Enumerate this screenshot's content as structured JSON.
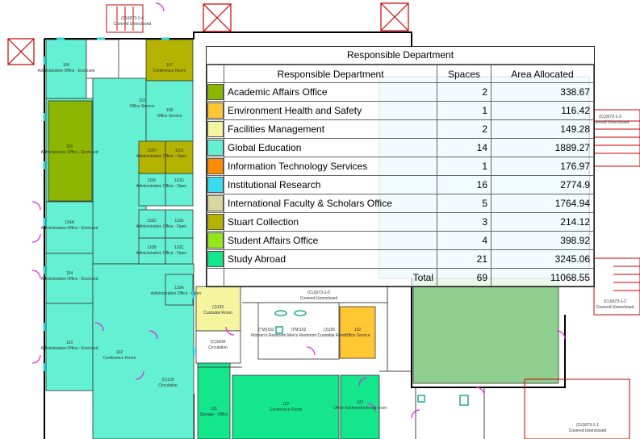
{
  "legend": {
    "title": "Responsible Department",
    "headers": {
      "department": "Responsible Department",
      "spaces": "Spaces",
      "area": "Area Allocated"
    },
    "rows": [
      {
        "color": "#8db600",
        "name": "Academic Affairs Office",
        "spaces": "2",
        "area": "338.67"
      },
      {
        "color": "#ffc732",
        "name": "Environment Health and Safety",
        "spaces": "1",
        "area": "116.42"
      },
      {
        "color": "#f5f5a0",
        "name": "Facilities Management",
        "spaces": "2",
        "area": "149.28"
      },
      {
        "color": "#64f0d2",
        "name": "Global Education",
        "spaces": "14",
        "area": "1889.27"
      },
      {
        "color": "#ff8c00",
        "name": "Information Technology Services",
        "spaces": "1",
        "area": "176.97"
      },
      {
        "color": "#3cdcf0",
        "name": "Institutional Research",
        "spaces": "16",
        "area": "2774.9"
      },
      {
        "color": "#d7d7a0",
        "name": "International Faculty & Scholars Office",
        "spaces": "5",
        "area": "1764.94"
      },
      {
        "color": "#b4b400",
        "name": "Stuart Collection",
        "spaces": "3",
        "area": "214.12"
      },
      {
        "color": "#96e61e",
        "name": "Student Affairs Office",
        "spaces": "4",
        "area": "398.92"
      },
      {
        "color": "#14e68c",
        "name": "Study Abroad",
        "spaces": "21",
        "area": "3245.06"
      }
    ],
    "total": {
      "label": "Total",
      "spaces": "69",
      "area": "11068.55"
    }
  },
  "rooms": {
    "r106": "106",
    "r106_name": "Administrative Office - Enclosed",
    "r107": "107",
    "r107_name": "Conference Room",
    "r105": "105",
    "r105_name": "Administrative Office - Enclosed",
    "r108": "108",
    "r108_name": "Office Service",
    "r110": "110",
    "r110_name": "Office Service",
    "r104a": "104A",
    "r104a_name": "Administrative Office - Enclosed",
    "r104": "104",
    "r104_name": "Administrative Office - Enclosed",
    "r103": "103",
    "r103_name": "Administrative Office - Enclosed",
    "r102": "102",
    "r102_name": "Conference Room",
    "c100": "(C)100",
    "c100_name": "Circulation",
    "c100a": "(C)100A",
    "c100a_name": "Circulation",
    "j133": "(J)133",
    "j133_name": "Custodial Room",
    "r132": "132",
    "r132_name": "Office Service",
    "r122": "122",
    "r122_name": "Conference Room",
    "r123": "123",
    "r123_name": "Office Kitchenette/break room",
    "r121": "121",
    "r121_name": "Storage - Office",
    "tw152": "(TW)152",
    "tm152": "(TM)152",
    "j155": "(J)155",
    "restroom_label": "Women's Restroom Men's Restroom Custodial Room",
    "cu_top": "(CU)073-1-4",
    "cu_top_name": "Covered Unenclosed",
    "cu_mid": "(CU)073-1-3",
    "cu_mid_name": "Covered Unenclosed",
    "cu_right": "(CU)073-1-3",
    "cu_right_name": "Covered Unenclosed",
    "cu_right2": "(CU)073-1-2",
    "cu_right2_name": "Covered Unenclosed",
    "cu_bottom": "(CU)073-1-1",
    "cu_bottom_name": "Covered Unenclosed",
    "cu_center": "(CU)073-1-0",
    "cu_center_name": "Covered Unenclosed",
    "sm_labels": [
      "110H",
      "110J",
      "110F",
      "110G",
      "110D",
      "110E",
      "110B",
      "110C",
      "110A"
    ],
    "sm_name": "Administrative Office - Open"
  }
}
